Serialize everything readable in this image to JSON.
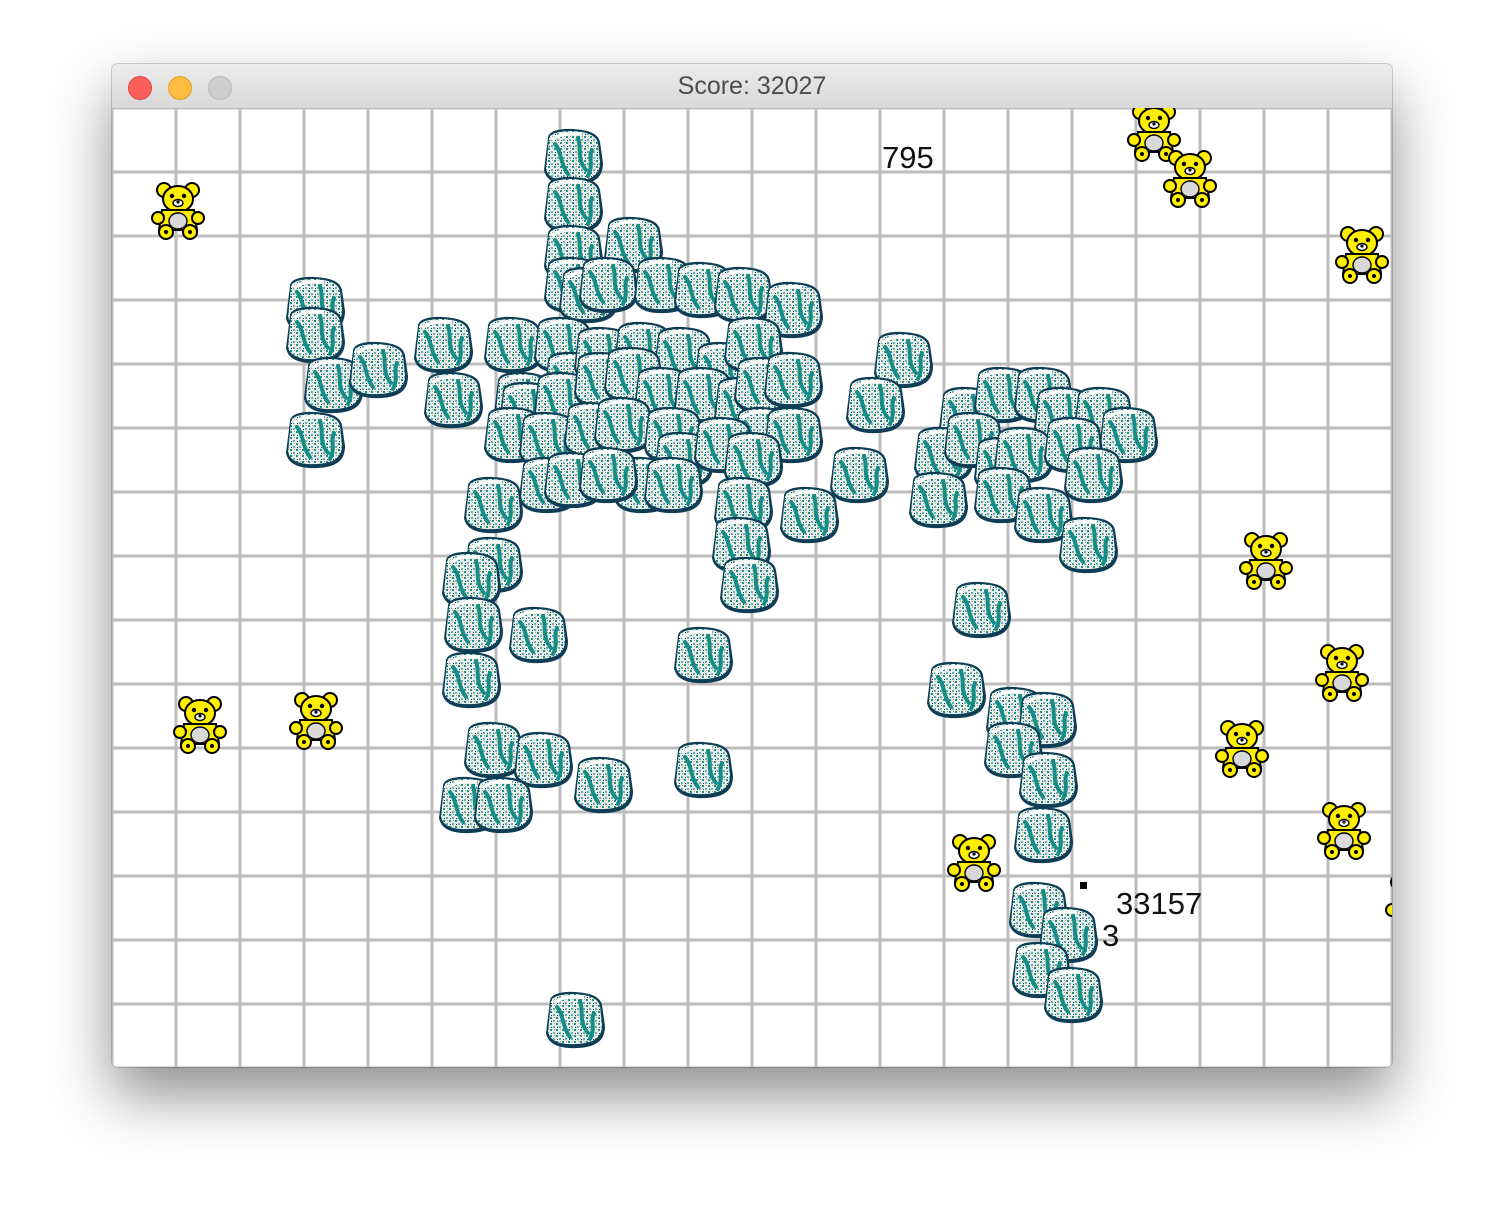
{
  "window": {
    "title": "Score: 32027"
  },
  "controls": {
    "close": "close-button",
    "minimize": "minimize-button",
    "zoom": "zoom-button"
  },
  "board": {
    "columns": 20,
    "rows": 15,
    "grid_color": "#bdbdbd",
    "floating_numbers": [
      {
        "text": "795"
      },
      {
        "text": "33157"
      },
      {
        "text": "3"
      }
    ]
  },
  "sprites": {
    "rock": "snow-rock",
    "bear": "yellow-teddy-bear"
  },
  "colors": {
    "rock_teal": "#158c86",
    "rock_dark": "#0e3d55",
    "rock_white": "#e9eeee",
    "bear_yellow": "#ffee00",
    "bear_outline": "#000000"
  }
}
